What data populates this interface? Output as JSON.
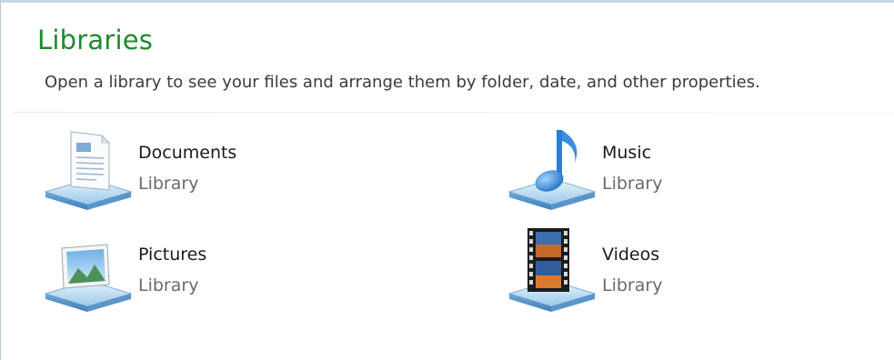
{
  "header": {
    "title": "Libraries",
    "subtitle": "Open a library to see your files and arrange them by folder, date, and other properties."
  },
  "libraries": [
    {
      "name": "Documents",
      "type": "Library",
      "icon": "documents-library-icon"
    },
    {
      "name": "Music",
      "type": "Library",
      "icon": "music-library-icon"
    },
    {
      "name": "Pictures",
      "type": "Library",
      "icon": "pictures-library-icon"
    },
    {
      "name": "Videos",
      "type": "Library",
      "icon": "videos-library-icon"
    }
  ],
  "colors": {
    "title": "#1e8a2e",
    "subtitle": "#3b3b3b",
    "secondary_text": "#6a6a6a",
    "platform_blue": "#7fb6e0"
  }
}
